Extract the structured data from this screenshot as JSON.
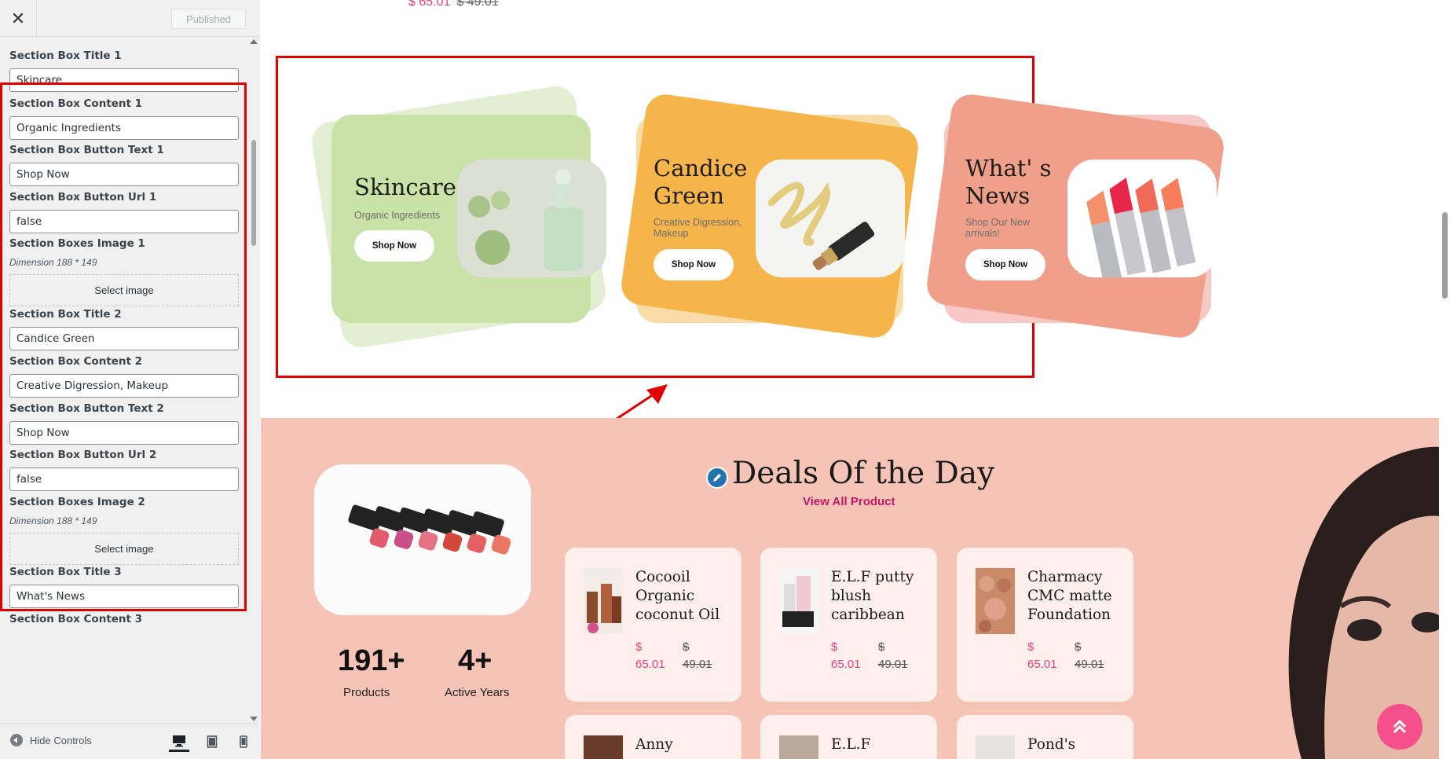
{
  "sidebar": {
    "close_label": "✕",
    "published_label": "Published",
    "fields": [
      {
        "label": "Section Box Title 1",
        "value": "Skincare"
      },
      {
        "label": "Section Box Content 1",
        "value": "Organic Ingredients"
      },
      {
        "label": "Section Box Button Text 1",
        "value": "Shop Now"
      },
      {
        "label": "Section Box Button Url 1",
        "value": "false"
      },
      {
        "label": "Section Boxes Image 1",
        "desc": "Dimension 188 * 149",
        "button": "Select image"
      },
      {
        "label": "Section Box Title 2",
        "value": "Candice Green"
      },
      {
        "label": "Section Box Content 2",
        "value": "Creative Digression, Makeup"
      },
      {
        "label": "Section Box Button Text 2",
        "value": "Shop Now"
      },
      {
        "label": "Section Box Button Url 2",
        "value": "false"
      },
      {
        "label": "Section Boxes Image 2",
        "desc": "Dimension 188 * 149",
        "button": "Select image"
      },
      {
        "label": "Section Box Title 3",
        "value": "What's News"
      },
      {
        "label": "Section Box Content 3",
        "value": ""
      }
    ],
    "footer": {
      "hide_controls": "Hide Controls"
    }
  },
  "preview": {
    "top_price": {
      "current": "$ 65.01",
      "old": "$ 49.01"
    },
    "promo_boxes": [
      {
        "title": "Skincare",
        "subtitle": "Organic Ingredients",
        "button": "Shop Now",
        "color": "#c9e2a8",
        "back_color": "#e2efd2"
      },
      {
        "title": "Candice Green",
        "subtitle": "Creative Digression, Makeup",
        "button": "Shop Now",
        "color": "#f5b54a",
        "back_color": "#f9dca5"
      },
      {
        "title": "What' s News",
        "subtitle": "Shop Our New arrivals!",
        "button": "Shop Now",
        "color": "#f0a08a",
        "back_color": "#f7c8c6"
      }
    ],
    "deals": {
      "title": "Deals Of the Day",
      "view_all": "View All Product",
      "stats": [
        {
          "num": "191+",
          "label": "Products"
        },
        {
          "num": "4+",
          "label": "Active Years"
        }
      ],
      "products": [
        {
          "name": "Cocooil Organic coconut Oil",
          "currency": "$",
          "price": "65.01",
          "old_currency": "$",
          "old_price": "49.01"
        },
        {
          "name": "E.L.F putty blush caribbean",
          "currency": "$",
          "price": "65.01",
          "old_currency": "$",
          "old_price": "49.01"
        },
        {
          "name": "Charmacy CMC matte Foundation",
          "currency": "$",
          "price": "65.01",
          "old_currency": "$",
          "old_price": "49.01"
        }
      ],
      "products_row2": [
        "Anny",
        "E.L.F",
        "Pond's"
      ]
    }
  }
}
